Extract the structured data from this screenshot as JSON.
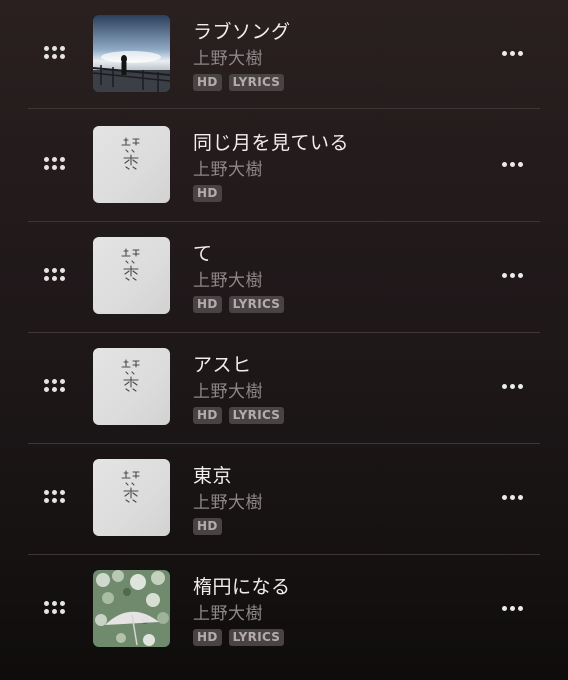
{
  "tracks": [
    {
      "title": "ラブソング",
      "artist": "上野大樹",
      "badges": [
        "HD",
        "LYRICS"
      ],
      "art": "pier-sunset"
    },
    {
      "title": "同じ月を見ている",
      "artist": "上野大樹",
      "badges": [
        "HD"
      ],
      "art": "white-calligraphy"
    },
    {
      "title": "て",
      "artist": "上野大樹",
      "badges": [
        "HD",
        "LYRICS"
      ],
      "art": "white-calligraphy"
    },
    {
      "title": "アスヒ",
      "artist": "上野大樹",
      "badges": [
        "HD",
        "LYRICS"
      ],
      "art": "white-calligraphy"
    },
    {
      "title": "東京",
      "artist": "上野大樹",
      "badges": [
        "HD"
      ],
      "art": "white-calligraphy"
    },
    {
      "title": "楕円になる",
      "artist": "上野大樹",
      "badges": [
        "HD",
        "LYRICS"
      ],
      "art": "umbrella-flowers"
    }
  ],
  "icons": {
    "drag_handle": "drag-handle-icon",
    "more": "more-options-icon"
  },
  "colors": {
    "background_top": "#2a2020",
    "background_bottom": "#0f0c0c",
    "title_text": "#f2eeee",
    "artist_text": "#8e8788",
    "badge_bg": "#4a4344",
    "badge_text": "#b3acad",
    "divider": "#3d3536"
  }
}
